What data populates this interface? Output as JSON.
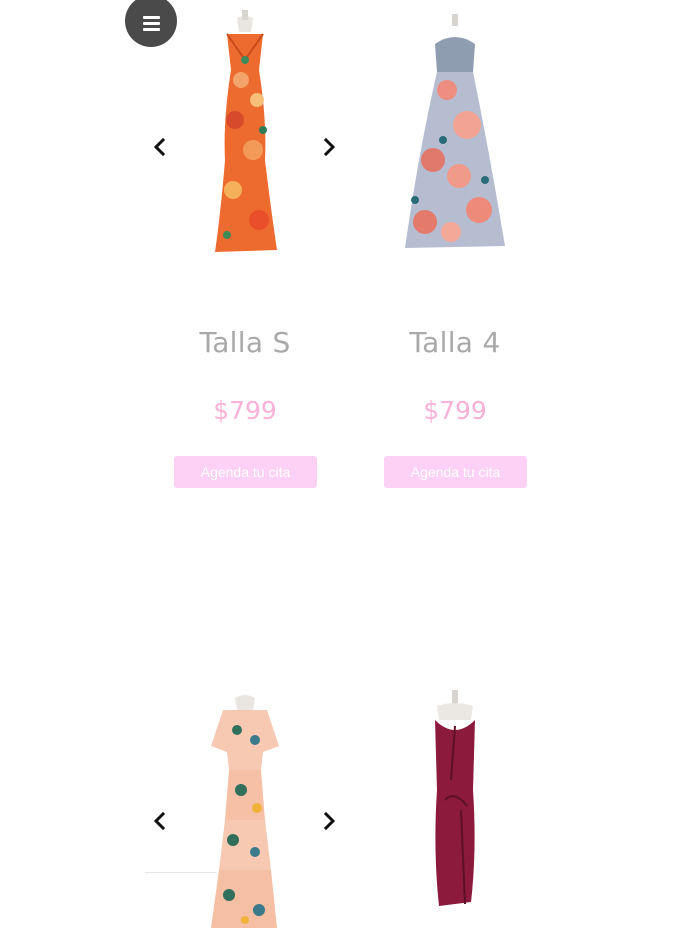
{
  "menu": {
    "icon": "hamburger-menu-icon"
  },
  "products": [
    {
      "title": "Talla S",
      "price": "$799",
      "cta": "Agenda tu cita",
      "image": "orange-floral-gown"
    },
    {
      "title": "Talla 4",
      "price": "$799",
      "cta": "Agenda tu cita",
      "image": "grey-floral-strapless-gown"
    },
    {
      "image": "peach-floral-tiered-dress"
    },
    {
      "image": "burgundy-velvet-gown"
    }
  ],
  "carousel": {
    "prev_icon": "chevron-left-icon",
    "next_icon": "chevron-right-icon"
  },
  "colors": {
    "title": "#a9a9a9",
    "price": "#f9b1d8",
    "cta_bg": "#fdd0f6",
    "menu_bg": "#4a4a4a"
  }
}
